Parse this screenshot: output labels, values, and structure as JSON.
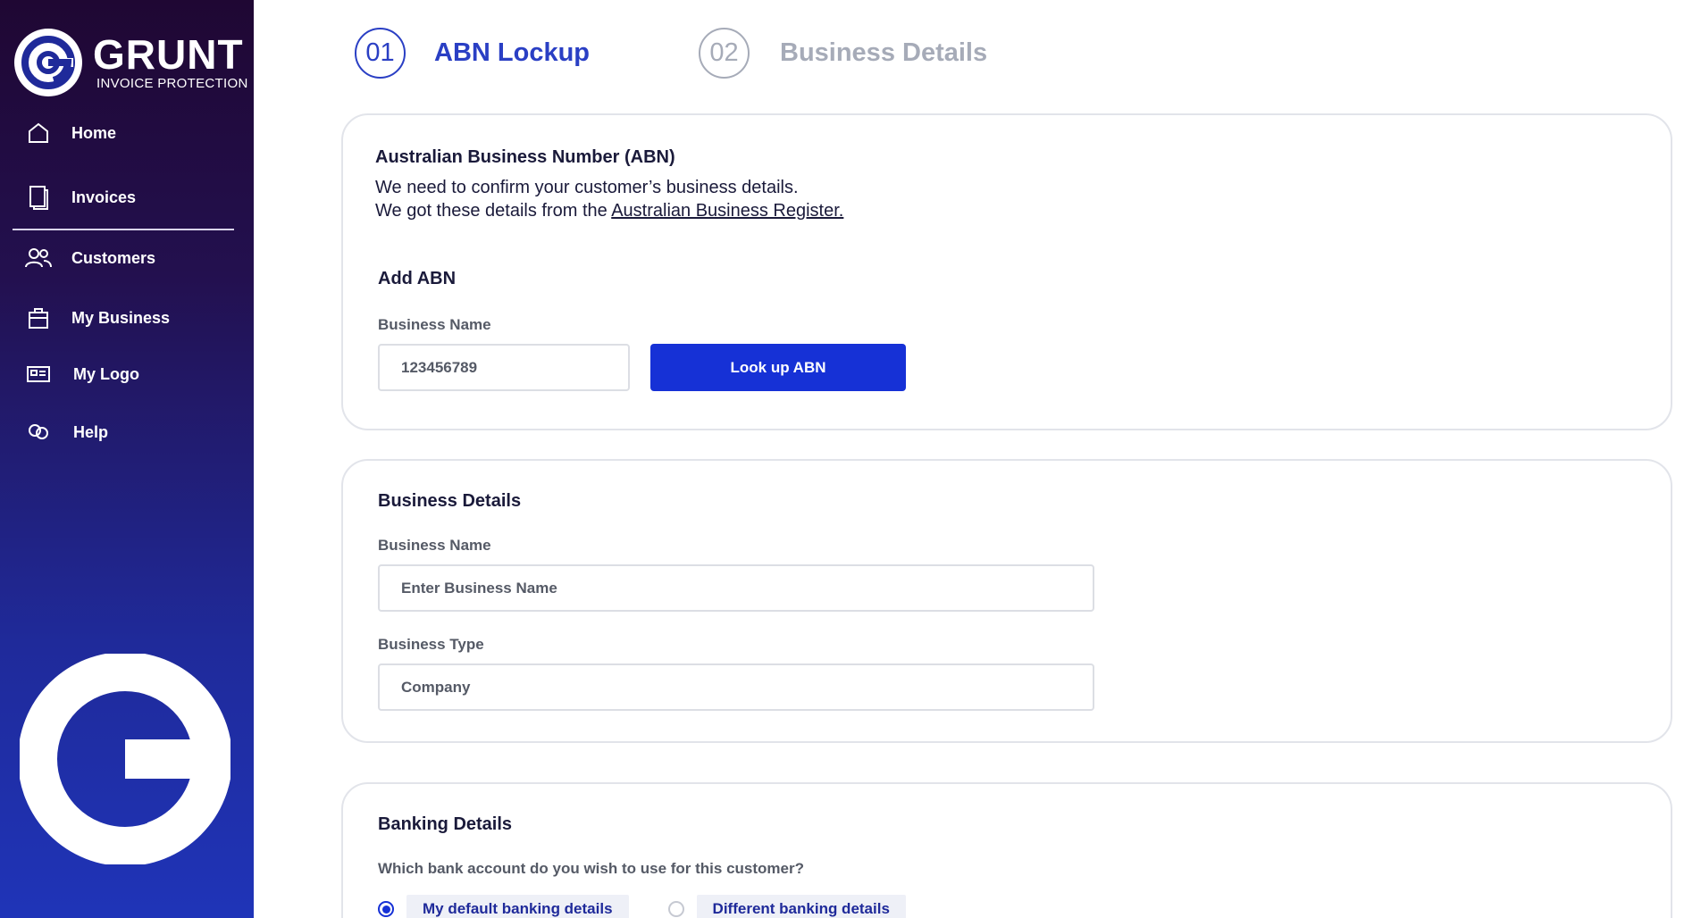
{
  "brand": {
    "name": "GRUNT",
    "tagline": "INVOICE PROTECTION"
  },
  "nav": {
    "items": [
      {
        "label": "Home",
        "icon": "home-icon"
      },
      {
        "label": "Invoices",
        "icon": "document-icon"
      },
      {
        "label": "Customers",
        "icon": "users-icon"
      },
      {
        "label": "My Business",
        "icon": "briefcase-icon"
      },
      {
        "label": "My Logo",
        "icon": "id-card-icon"
      },
      {
        "label": "Help",
        "icon": "chat-icon"
      }
    ]
  },
  "stepper": [
    {
      "number": "01",
      "label": "ABN Lockup",
      "state": "active"
    },
    {
      "number": "02",
      "label": "Business Details",
      "state": "inactive"
    }
  ],
  "abn_card": {
    "title": "Australian Business Number (ABN)",
    "desc_line1": "We need to confirm your customer’s business details.",
    "desc_line2_prefix": "We got these details from the ",
    "desc_link": "Australian Business Register.",
    "section_title": "Add ABN",
    "field_label": "Business Name",
    "field_value": "123456789",
    "button_label": "Look up ABN"
  },
  "business_card": {
    "section_title": "Business Details",
    "name_label": "Business Name",
    "name_placeholder": "Enter Business Name",
    "type_label": "Business Type",
    "type_value": "Company"
  },
  "banking_card": {
    "section_title": "Banking Details",
    "question": "Which bank account do you wish to use for this customer?",
    "options": [
      {
        "label": "My default banking details",
        "checked": true
      },
      {
        "label": "Different banking details",
        "checked": false
      }
    ]
  },
  "colors": {
    "accent": "#1631d6",
    "active_step": "#2a3fc4",
    "inactive_step": "#a6abb8"
  }
}
